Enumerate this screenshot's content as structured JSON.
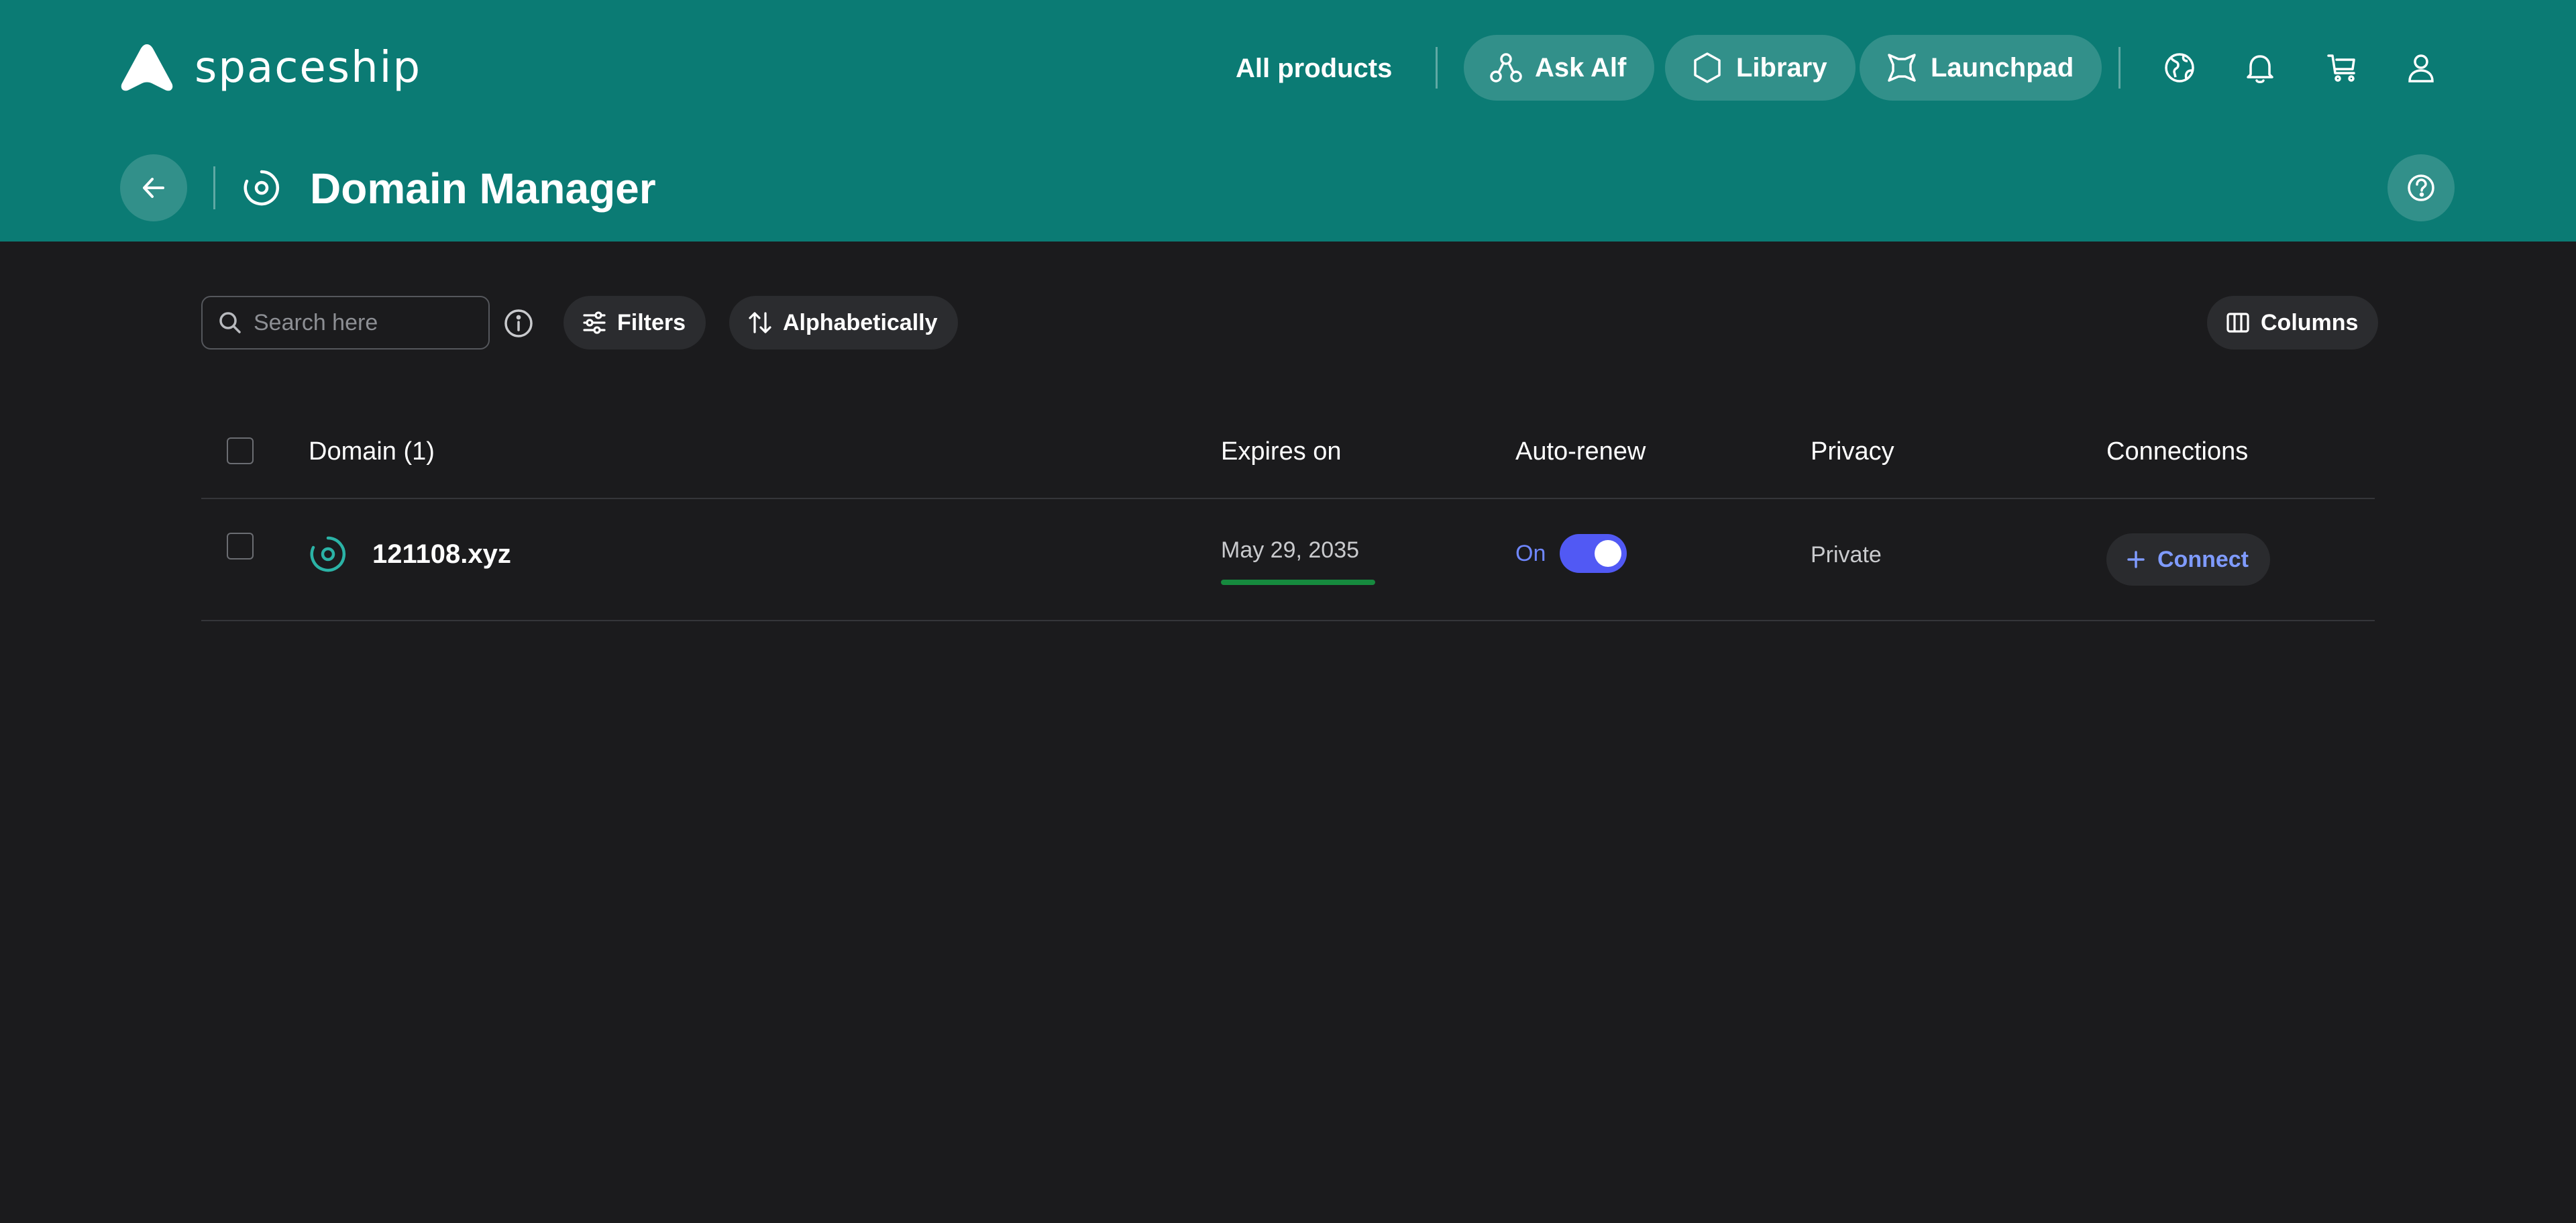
{
  "brand": {
    "name": "spaceship"
  },
  "nav": {
    "all_products": "All products",
    "ask_alf": "Ask Alf",
    "library": "Library",
    "launchpad": "Launchpad"
  },
  "page": {
    "title": "Domain Manager"
  },
  "toolbar": {
    "search_placeholder": "Search here",
    "filters": "Filters",
    "sort": "Alphabetically",
    "columns": "Columns"
  },
  "table": {
    "headers": {
      "domain": "Domain (1)",
      "expires": "Expires on",
      "auto_renew": "Auto-renew",
      "privacy": "Privacy",
      "connections": "Connections"
    },
    "rows": [
      {
        "domain": "121108.xyz",
        "expires": "May 29, 2035",
        "expiry_progress": 1.0,
        "auto_renew_label": "On",
        "auto_renew_on": true,
        "privacy": "Private",
        "connect_label": "Connect"
      }
    ]
  },
  "colors": {
    "header_bg": "#0b7b74",
    "page_bg": "#1b1b1d",
    "accent_blue": "#5159f4",
    "link_blue": "#7f9bff",
    "expiry_green": "#168a3e",
    "domain_icon_teal": "#2bb3a6"
  },
  "icons": {
    "top": [
      "language-icon",
      "bell-icon",
      "cart-icon",
      "user-icon"
    ],
    "help": "help-icon",
    "back": "arrow-left-icon"
  }
}
